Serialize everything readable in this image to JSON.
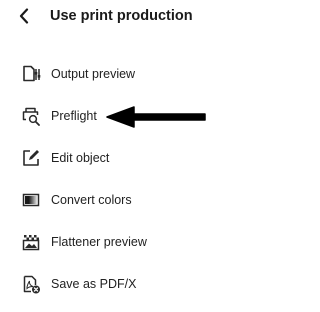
{
  "panel": {
    "title": "Use print production",
    "back_icon": "chevron-left-icon"
  },
  "items": [
    {
      "label": "Output preview",
      "icon": "output-preview-icon"
    },
    {
      "label": "Preflight",
      "icon": "preflight-icon"
    },
    {
      "label": "Edit object",
      "icon": "edit-object-icon"
    },
    {
      "label": "Convert colors",
      "icon": "convert-colors-icon"
    },
    {
      "label": "Flattener preview",
      "icon": "flattener-preview-icon"
    },
    {
      "label": "Save as PDF/X",
      "icon": "save-pdfx-icon"
    }
  ],
  "annotation": {
    "icon": "arrow-left-icon",
    "color": "#000000",
    "points_to": "Preflight"
  }
}
